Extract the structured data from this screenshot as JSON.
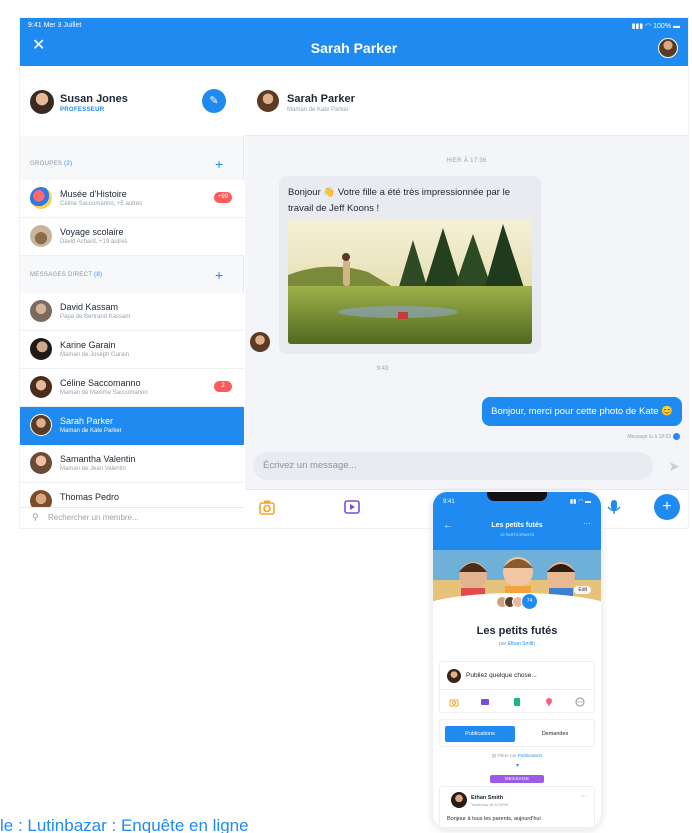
{
  "tablet": {
    "status": {
      "time": "9:41  Mer 3 Juillet",
      "battery": "100%"
    },
    "header": {
      "close": "✕",
      "title": "Sarah Parker"
    },
    "me": {
      "name": "Susan Jones",
      "role": "PROFESSEUR"
    },
    "groups": {
      "label": "GROUPES",
      "count": "(2)",
      "items": [
        {
          "name": "Musée d'Histoire",
          "sub": "Céline Saccomanno, +5 autres",
          "badge": "+99"
        },
        {
          "name": "Voyage scolaire",
          "sub": "David Achard, +19 autres",
          "badge": ""
        }
      ]
    },
    "direct": {
      "label": "MESSAGES DIRECT",
      "count": "(8)",
      "items": [
        {
          "name": "David Kassam",
          "sub": "Papa de Bertrand Kassam",
          "badge": ""
        },
        {
          "name": "Karine Garain",
          "sub": "Maman de Joseph Garain",
          "badge": ""
        },
        {
          "name": "Céline Saccomanno",
          "sub": "Maman de Maxime Saccomanno",
          "badge": "2"
        },
        {
          "name": "Sarah Parker",
          "sub": "Maman de Kate Parker",
          "badge": ""
        },
        {
          "name": "Samantha Valentin",
          "sub": "Maman de Jean Valentin",
          "badge": ""
        },
        {
          "name": "Thomas Pedro",
          "sub": "",
          "badge": ""
        }
      ]
    },
    "search": {
      "placeholder": "Rechercher un membre..."
    },
    "chat": {
      "name": "Sarah Parker",
      "sub": "Maman de Kate Parker",
      "date": "HIER À 17:36",
      "incoming": "Bonjour 👋 Votre fille a été très impressionnée par le travail de Jeff Koons !",
      "time": "9:43",
      "outgoing": "Bonjour, merci pour cette photo de Kate 😊",
      "read": "Message lu à 18:03",
      "input_placeholder": "Écrivez un message...",
      "fab": "+"
    },
    "colors": {
      "accent": "#1f8bf0",
      "badge": "#ff5a5a"
    }
  },
  "phone": {
    "status": {
      "time": "9:41"
    },
    "title": "Les petits futés",
    "subtitle": "12 PARTICIPANTS",
    "edit": "Edit",
    "group": "Les petits futés",
    "by_prefix": "par",
    "by_name": "Ethan Smith",
    "post_placeholder": "Publiez quelque chose...",
    "tabs": [
      "Publications",
      "Demandes"
    ],
    "filter_prefix": "Filtrer par",
    "filter_value": "Publications",
    "tag": "MESSAGE",
    "post": {
      "author": "Ethan Smith",
      "time": "Yesterday at 3:00PM",
      "body": "Bonjour à tous les parents, aujourd'hui"
    }
  },
  "caption": "le : Lutinbazar : Enquête en ligne"
}
